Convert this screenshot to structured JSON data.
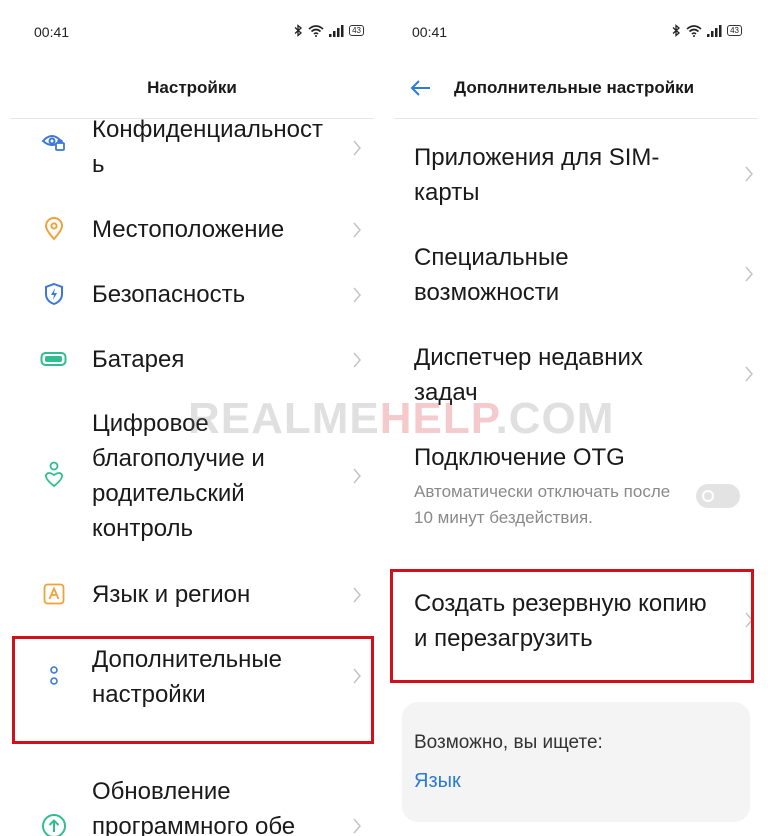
{
  "left_screen": {
    "status": {
      "time": "00:41",
      "battery": "43"
    },
    "title": "Настройки",
    "items": [
      {
        "label": "Конфиденциальность",
        "icon": "privacy-eye-icon"
      },
      {
        "label": "Местоположение",
        "icon": "location-pin-icon"
      },
      {
        "label": "Безопасность",
        "icon": "shield-bolt-icon"
      },
      {
        "label": "Батарея",
        "icon": "battery-icon"
      },
      {
        "label": "Цифровое благополучие и родительский контроль",
        "icon": "wellbeing-heart-icon"
      },
      {
        "label": "Язык и регион",
        "icon": "language-a-icon"
      },
      {
        "label": "Дополнительные настройки",
        "icon": "more-dots-icon"
      },
      {
        "label": "Обновление программного обе",
        "icon": "update-arrow-icon"
      }
    ]
  },
  "right_screen": {
    "status": {
      "time": "00:41",
      "battery": "43"
    },
    "title": "Дополнительные настройки",
    "items": [
      {
        "label": "Приложения для SIM-карты"
      },
      {
        "label": "Специальные возможности"
      },
      {
        "label": "Диспетчер недавних задач"
      },
      {
        "label": "Подключение OTG",
        "sub": "Автоматически отключать после 10 минут бездействия."
      },
      {
        "label": "Создать резервную копию и перезагрузить"
      }
    ],
    "suggest": {
      "question": "Возможно, вы ищете:",
      "link": "Язык"
    }
  },
  "watermark": {
    "part1": "REALME",
    "part2": "HELP",
    "part3": ".COM"
  },
  "colors": {
    "accent": "#2b7bd8",
    "highlight": "#d0111b",
    "icon_orange": "#f0a23a",
    "icon_green": "#2fbf8e"
  }
}
